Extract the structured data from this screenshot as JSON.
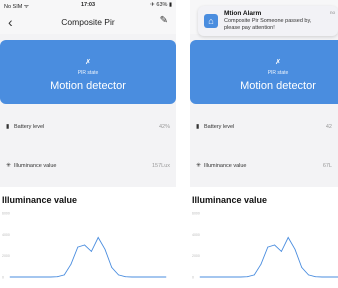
{
  "status": {
    "carrier": "No SIM ᯤ",
    "time": "17:03",
    "battery": "✈ 63% ▮"
  },
  "nav": {
    "title": "Composite Pir"
  },
  "hero": {
    "icon": "✗",
    "state": "PIR state",
    "name": "Motion detector"
  },
  "battery": {
    "icon": "▮",
    "label": "Battery level",
    "value": "42%"
  },
  "illuminance": {
    "icon": "✳",
    "label": "Illuminance value",
    "value": "157Lux"
  },
  "chart": {
    "title": "Illuminance value",
    "yticks": [
      "6000",
      "4000",
      "2000",
      "0"
    ]
  },
  "chart_data": {
    "type": "line",
    "title": "Illuminance value",
    "ylim": [
      0,
      6000
    ],
    "y_ticks": [
      0,
      2000,
      4000,
      6000
    ],
    "x": [
      0,
      1,
      2,
      3,
      4,
      5,
      6,
      7,
      8,
      9,
      10,
      11,
      12,
      13,
      14,
      15,
      16,
      17,
      18,
      19,
      20,
      21,
      22,
      23
    ],
    "values": [
      0,
      0,
      0,
      0,
      0,
      0,
      0,
      30,
      200,
      1200,
      2800,
      3000,
      2400,
      3700,
      2600,
      900,
      200,
      30,
      0,
      0,
      0,
      0,
      0,
      0
    ],
    "grid": false
  },
  "notification": {
    "title": "Mtion Alarm",
    "message": "Composite Pir Someone passed by, please pay attention!",
    "when": "no"
  },
  "right": {
    "battery_value": "42",
    "illuminance_value": "67L"
  }
}
